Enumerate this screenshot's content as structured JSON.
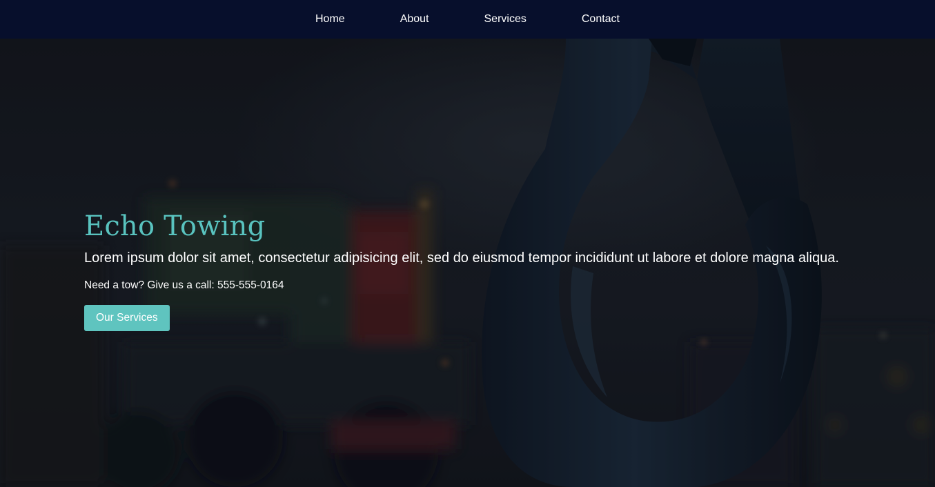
{
  "nav": {
    "items": [
      {
        "label": "Home"
      },
      {
        "label": "About"
      },
      {
        "label": "Services"
      },
      {
        "label": "Contact"
      }
    ]
  },
  "hero": {
    "title": "Echo Towing",
    "lead": "Lorem ipsum dolor sit amet, consectetur adipisicing elit, sed do eiusmod tempor incididunt ut labore et dolore magna aliqua.",
    "call_text": "Need a tow? Give us a call: 555-555-0164",
    "button_label": "Our Services"
  },
  "colors": {
    "nav_background": "#070f2c",
    "accent": "#59c3bf",
    "button": "#5fc4bf",
    "text": "#ffffff"
  }
}
